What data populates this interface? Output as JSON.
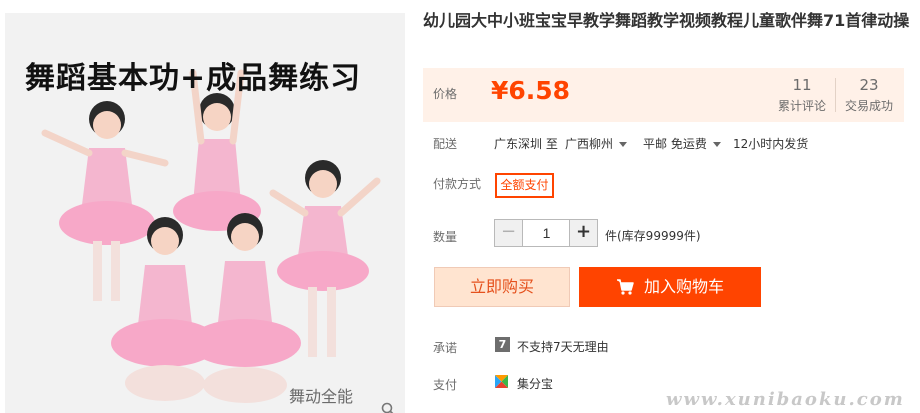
{
  "gallery": {
    "banner": "舞蹈基本功+成品舞练习",
    "watermark": "舞动全能",
    "zoom_icon": "magnifier-icon"
  },
  "product": {
    "title": "幼儿园大中小班宝宝早教学舞蹈教学视频教程儿童歌伴舞71首律动操"
  },
  "price": {
    "label": "价格",
    "value": "¥6.58",
    "reviews_count": "11",
    "reviews_label": "累计评论",
    "trades_count": "23",
    "trades_label": "交易成功",
    "accent": "#ff4400"
  },
  "shipping": {
    "label": "配送",
    "from": "广东深圳 至",
    "to": "广西柳州",
    "method": "平邮 免运费",
    "dispatch": "12小时内发货"
  },
  "payment_method": {
    "label": "付款方式",
    "option": "全额支付"
  },
  "quantity": {
    "label": "数量",
    "minus": "−",
    "value": "1",
    "plus": "+",
    "stock": "件(库存99999件)"
  },
  "actions": {
    "buy_now": "立即购买",
    "add_to_cart": "加入购物车",
    "cart_icon": "cart-icon"
  },
  "promise": {
    "label": "承诺",
    "icon_text": "7",
    "text": "不支持7天无理由"
  },
  "pay": {
    "label": "支付",
    "icon": "jifenbao-icon",
    "text": "集分宝"
  },
  "site_watermark": "www.xunibaoku.com"
}
